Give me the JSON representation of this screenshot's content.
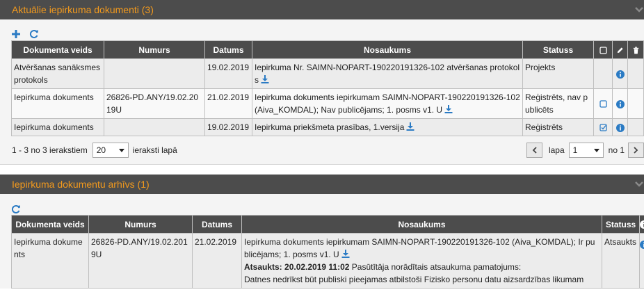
{
  "current": {
    "title": "Aktuālie iepirkuma dokumenti (3)",
    "columns": [
      "Dokumenta veids",
      "Numurs",
      "Datums",
      "Nosaukums",
      "Statuss"
    ],
    "rows": [
      {
        "type": "Atvēršanas sanāksmes protokols",
        "number": "",
        "date": "19.02.2019",
        "name": "Iepirkuma Nr. SAIMN-NOPART-190220191326-102 atvēršanas protokols",
        "status": "Projekts",
        "checkbox": "none"
      },
      {
        "type": "Iepirkuma dokuments",
        "number": "26826-PD.ANY/19.02.2019U",
        "date": "21.02.2019",
        "name": "Iepirkuma dokuments iepirkumam SAIMN-NOPART-190220191326-102 (Aiva_KOMDAL); Nav publicējams; 1. posms v1. U",
        "status": "Reģistrēts, nav publicēts",
        "checkbox": "unchecked"
      },
      {
        "type": "Iepirkuma dokuments",
        "number": "",
        "date": "19.02.2019",
        "name": "Iepirkuma priekšmeta prasības, 1.versija",
        "status": "Reģistrēts",
        "checkbox": "checked"
      }
    ],
    "pager": {
      "summary": "1 - 3 no 3 ierakstiem",
      "per_page": "20",
      "per_page_suffix": "ieraksti lapā",
      "page_label": "lapa",
      "page": "1",
      "of_label": "no 1"
    }
  },
  "archive": {
    "title": "Iepirkuma dokumentu arhīvs (1)",
    "columns": [
      "Dokumenta veids",
      "Numurs",
      "Datums",
      "Nosaukums",
      "Statuss"
    ],
    "rows": [
      {
        "type": "Iepirkuma dokuments",
        "number": "26826-PD.ANY/19.02.2019U",
        "date": "21.02.2019",
        "name": "Iepirkuma dokuments iepirkumam SAIMN-NOPART-190220191326-102 (Aiva_KOMDAL); Ir publicējams; 1. posms v1. U",
        "cancel_label": "Atsaukts: 20.02.2019 11:02",
        "cancel_text": "Pasūtītāja norādītais atsaukuma pamatojums:",
        "cancel_reason": "Datnes nedrīkst būt publiski pieejamas atbilstoši Fizisko personu datu aizsardzības likumam",
        "status": "Atsaukts"
      }
    ]
  },
  "colors": {
    "header_bg": "#4c4c4c",
    "header_text": "#f39a1d",
    "icon_blue": "#2b7bc4"
  }
}
